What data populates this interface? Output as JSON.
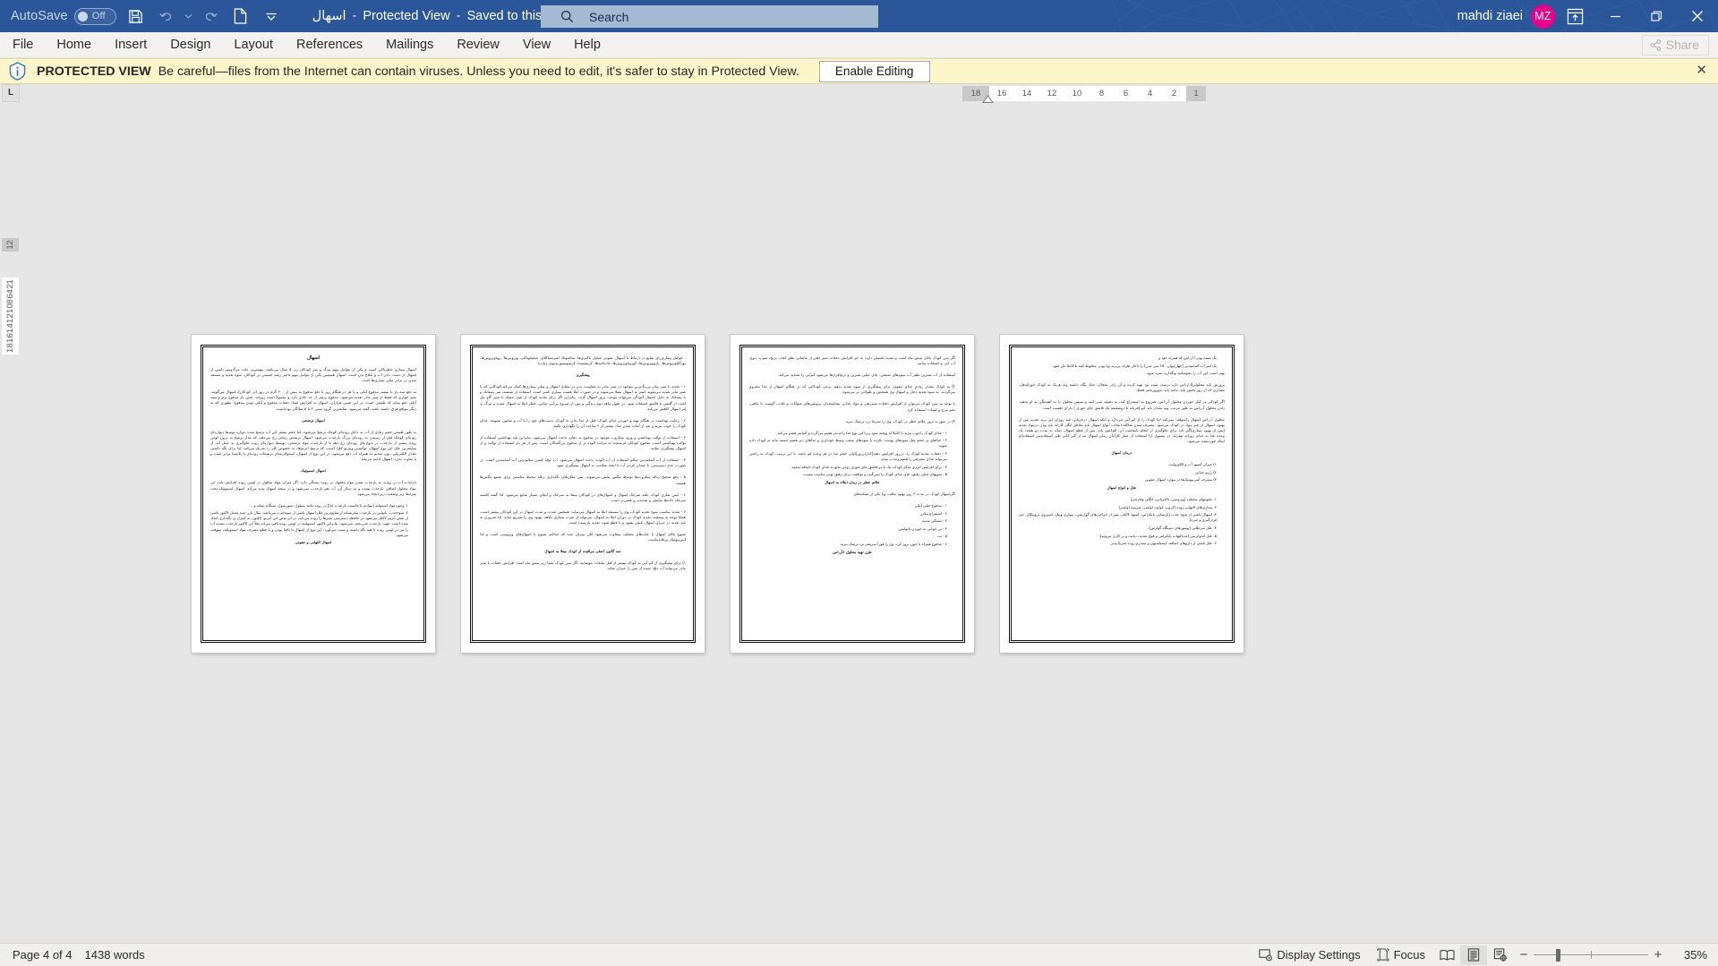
{
  "titlebar": {
    "autosave_label": "AutoSave",
    "autosave_state": "Off",
    "qat": [
      {
        "name": "save-icon",
        "tooltip": "Save"
      },
      {
        "name": "undo-icon",
        "tooltip": "Undo"
      },
      {
        "name": "redo-icon",
        "tooltip": "Redo"
      },
      {
        "name": "new-file-icon",
        "tooltip": "New"
      },
      {
        "name": "customize-qat-chevron-icon",
        "tooltip": "Customize Quick Access Toolbar"
      }
    ],
    "document_name": "اسهال",
    "protected_view_label": "Protected View",
    "save_location": "Saved to this PC",
    "user_name": "mahdi ziaei",
    "avatar_initials": "MZ",
    "avatar_color": "#e3008c",
    "accent_color": "#2b579a",
    "window_buttons": [
      "minimize",
      "restore",
      "close"
    ]
  },
  "search": {
    "placeholder": "Search",
    "icon": "search-icon"
  },
  "ribbon": {
    "tabs": [
      {
        "label": "File"
      },
      {
        "label": "Home"
      },
      {
        "label": "Insert"
      },
      {
        "label": "Design"
      },
      {
        "label": "Layout"
      },
      {
        "label": "References"
      },
      {
        "label": "Mailings"
      },
      {
        "label": "Review"
      },
      {
        "label": "View"
      },
      {
        "label": "Help"
      }
    ],
    "share_label": "Share"
  },
  "protected_view": {
    "icon": "shield-info-icon",
    "heading": "PROTECTED VIEW",
    "message": "Be careful—files from the Internet can contain viruses. Unless you need to edit, it's safer to stay in Protected View.",
    "enable_editing_label": "Enable Editing",
    "close_label": "✕",
    "background_color": "#fdf6ca"
  },
  "rulers": {
    "tabstop_marker": "L",
    "horizontal_numbers": [
      "18",
      "16",
      "14",
      "12",
      "10",
      "8",
      "6",
      "4",
      "2",
      "1"
    ],
    "vertical_numbers": [
      "2",
      "1",
      "1",
      "2",
      "4",
      "6",
      "8",
      "10",
      "12",
      "14",
      "16",
      "18"
    ]
  },
  "statusbar": {
    "page_indicator": "Page 4 of 4",
    "word_count": "1438 words",
    "display_settings_label": "Display Settings",
    "display_settings_icon": "display-settings-icon",
    "focus_label": "Focus",
    "focus_icon": "focus-icon",
    "view_buttons": [
      {
        "name": "read-mode-icon",
        "active": false
      },
      {
        "name": "print-layout-icon",
        "active": true
      },
      {
        "name": "web-layout-icon",
        "active": false
      }
    ],
    "zoom_out_label": "−",
    "zoom_in_label": "+",
    "zoom_level": "35%"
  },
  "document": {
    "page_count": 4,
    "current_page": 4,
    "pages": [
      {
        "number": 1,
        "title": "اسهال",
        "blocks": [
          {
            "type": "p",
            "bold": false,
            "text": "اسهال بیماری خطرناکی است و یکی از عوامل مهم مرگ و میر کودکان زیر ۵ سال می‌باشد. مهمترین علت مرگ‌ومیر ناشی از اسهال از دست دادن آب و املاح بدن است. اسهال همچنین یکی از عوامل مهم تاخیر رشد جسمی در کودکان، سوء تغذیه و مستعد شدن در برابر سایر بیماری‌ها است."
          },
          {
            "type": "p",
            "bold": false,
            "text": "به دفع سه بار یا بیشتر مدفوع آبکی و یا هر در هنگام روز یا دفع مدفوع به بیش از ۲۰۰ گرم در روز (در کودکان)، اسهال می‌گویند. شیر خواری که فقط از شیر مادر تغذیه می‌شود، مدفوع نرم‌تر از حد عادی دارد و معمولاً است روزانه، چنین بار مدفوع نرم و نیمه آبکی دفع نماید که طبیعی است. در این ضمن هزاران، اسهال به افزایش تعداد دفعات مدفوع و آبکی بودن مدفوع، بطوری که به دیگر مواقع فرق داشته باشد، گفته می‌شود. شایعترین گروه سنی ۲ تا ۵ سالگی بوده‌است."
          },
          {
            "type": "p",
            "bold": true,
            "text": "اسهال ترشحی"
          },
          {
            "type": "p",
            "bold": false,
            "text": "به طور طبیعی حجم زیادی از آب به داخل روده‌ای کوچک ترشح می‌شود، اما حجم بیشتر این آب ترشح شده دوباره توسط دیواره‌ای روده‌ای کوچک قبل از رسیدن به روده‌ای بزرگ بازجذب می‌شود. اسهال ترشحی زمانی رخ می‌دهد، که مدل ترشح به درون لومن روده بیشتر از بازجذب در دیواره‌ای روده‌ای رخ دهد یا از بازجذب مواد ترشحی، توسط دیواره‌ای روده جلوگیری به عمل آید. از شایعترین علل این نوع اسهال، توکسین ویبریو کلرا است، که ترشح آنزیم‌ها، به خصوص کلر را تحریک می‌کند، لذا برای نگه داشتن تعادل الکتریکی، یون سدیم به همراه آب دفع می‌شود. در این نوع از اسهال، اسمولاریته‌ای ترشحات روده‌ای با پلاسما برابر است و یا تفاوت ندارد. اسهال ادامه می‌یابد."
          },
          {
            "type": "p",
            "bold": true,
            "text": "اسهال اسموتیک"
          },
          {
            "type": "p",
            "bold": false,
            "text": "بازجذب آب در روده، به بازجذب شدن مواد محلول در روده بستگی دارد. اگر میزان مواد محلول در لومن روده افزایش یابد، این مواد محلول اضافی بازجذب نشده و به دنبال آن، آب هم بازجذب نمی‌شود و در نتیجه اسهال پدید می‌آید. اسهال اسموتیک تحت شرایط زیر وضعیت زیر ایجاد می‌شود:"
          },
          {
            "type": "li",
            "text": "۱. وجود مواد اسمولیه (موادی با خاصیت بازجذب غذا) در روده مانند متیلول، سوربیتول، سنگانه شاید و ..."
          },
          {
            "type": "li",
            "text": "۲. سوءجذب: ناتوانی در بازجذب بیفرشتاند از شایع‌ترین علل اسهال ناشی از سوءجذب می‌باشد. مثال بارز عدم تحمل لاکتوز ناشی از نقص آنزیم لاکتاز می‌شود در حافظه دسترسی شیرها را روده می‌یابد، در اثر نقص این آنزیم، لاکتوز، به کنترل بر نگه‌داری ایجاد شده است. جهت بازجذب غیرریختز نمی‌شود، بنابراین لاکتوز اسمولیته در لومن روده باقی می‌اند مثلاً این لاکتوز بازجذب نشده آب را نیز در لومن روده با هیه نگه داشته و سبب می‌آورد، این نوع از اسهال با تافنا بودن و یا قطع مصرف مواد اسمویکف متوقف می‌شود."
          },
          {
            "type": "p",
            "bold": true,
            "text": "اسهال التهابی و عفونی"
          }
        ]
      },
      {
        "number": 2,
        "title": "",
        "blocks": [
          {
            "type": "p",
            "bold": false,
            "text": ". عوامل بیماری‌زای شایع در ارتباط با اسهال عفونی شامل باکتری‌ها: سالمونلا، اشرشیاکلای، شاپیلوباکتر، ویروس‌ها: روتاویروس‌ها، نورآلکویروس‌ها، پاروویروس‌ها، کوروناویروس‌ها، تک‌یاخته‌ها: کریستیدیا، کریپتوسپوریدیوم، ژیاردیا"
          },
          {
            "type": "p",
            "bold": true,
            "text": "پیشگیری"
          },
          {
            "type": "p",
            "bold": false,
            "text": "۱ - تغذیه با شیر مادر پررنگ‌ترین موجود در شیر مادر به مقاومت بدن در مقابل اسهال و سایر بیماری‌ها کمک می‌کند.کودکانی که با شیر مادر تغذیه می‌شوند کمتر به اسهال مبتلا می‌شوند و در صورت ابتلا هست بیماری کمتر است. استفاده از شیشه، سر پستانک و یا پستانک به دلیل احتمال آلودگی می‌تواند موجب بروز اسهال گردد. بنابراین اگر برای تغذیه کودک از شیر خشک یا شیر گاو نیاز است از گلنش یا قاشق استفاده شود. در طول ماهه دوم زندگی و پس از شروع بی‌آبی تماس، خطر ابتلا به اسهال شدید و مرگ بر اثر اسهال کاهش می‌یابد."
          },
          {
            "type": "p",
            "bold": false,
            "text": "۲ - رعایت بهداشت در هنگام تهیه و خوردن غذای کودک: قبل از غذا دادن به کودک، دست‌های خود را با آب و صابون بشویید. غذای کودک را خوب بپزید و بعد از آماده شدن غذا، بیشتر از ۲ ساعت آن را نگهداری نکنید."
          },
          {
            "type": "p",
            "bold": false,
            "text": "۳ - استفاده از توالت بهداشتی و ورود میکروب موجود در مدفوع به دهان، باعث اسهال می‌شود، بنابراین باید بهداشتی استفاده از توالت بهداشتی است. مدفوع کودکان فرستنده به مراتب آلوده تر از مدفوع بزرگسالان است. پس از هر بار استفاده از توالت و از اسهال پیشگیری نمایید."
          },
          {
            "type": "p",
            "bold": false,
            "text": "۴ - استفاده از آب آشامیدنی سالم استفاده از آب آلوده، باعث اسهال می‌شود. آب لوله کشی سالم‌ترین آب آشامیدنی است. در صورت عدم دسترسی، با چندان کردن آب تا ایجاد سلامت به اسهال پیشگیری شود."
          },
          {
            "type": "p",
            "bold": false,
            "text": "۵ - دفع صحیح زباله میکروب‌ها توسط مگس پخش می‌شوند، پس مکان‌های نگه‌داری زباله محیط مناسبی برای تجمع مگس‌ها هستند."
          },
          {
            "type": "p",
            "bold": false,
            "text": "۶ - ایمن سازی کودک علیه سرخک اسهال و اسهال‌های در کودکان مبتلا به سرخک و آبچای بسیار شایع می‌شود. لذا گفته کاشته سرخک داده‌ها شایعتر و شدیدتر و همین‌تر است."
          },
          {
            "type": "p",
            "bold": false,
            "text": "۷ - تغذیه مناسب سوء تغذیه کودک، وی را مستعد ابتلا به اسهال می‌نماید. همچنین شدت و مدت اسهال در این کودکان بیشتر است. همانا توجه به وضعیت تغذیه کودک در دوران ابتلا به اسهال، می‌تواند از شدت بیماری بکاهد. بهبود وی را تسریع نماید. لذا ضروری به باید تغذیه در جریان اسهال بابقی بشود و یا قطع شود، تغذیه بازیست است."
          },
          {
            "type": "p",
            "bold": false,
            "text": "شیوع بالای اسهال با علت‌های مختلف متفاوت می‌شود لکن میزان عده که حداکثر شیوع با اسهال‌های ویروسی است و لذا آنتی‌بیوتیک بی‌فایده‌است."
          },
          {
            "type": "p",
            "bold": true,
            "text": "سه گانون اصلی مراقبت از کودک مبتلا به اسهال"
          },
          {
            "type": "p",
            "bold": false,
            "text": "۱) برای پیشگیری از کم آبی به کودک بیشتر از قبل مایعات بنوشانید. اگر سن کودک شما زیر شش ماه است افزایش دفعات با شیر مادر می‌تواند آب دلخ عمده از نمن را جبران نماید."
          }
        ]
      },
      {
        "number": 3,
        "title": "",
        "blocks": [
          {
            "type": "p",
            "bold": false,
            "text": "اگر سن کودک بالای شش ماه است و تغذیه تکمیلی دارد، به جز افزایش دفعات شیر دهی از مایعاتی نظیر لعاب برنج، سوپ، دوغ، آب انی و استفاده نمایید."
          },
          {
            "type": "p",
            "bold": false,
            "text": "استفاده از آب شیرین نظیر آب میوه‌های صنعتی، چای خیلی شیرین و نرم‌افزار‌ها می‌شود کم‌آبی را تشدید می‌کند."
          },
          {
            "type": "p",
            "bold": false,
            "text": "۲) به کودک مقدار زیادی غذای مقوی، برای پیشگیری از سوء تغذیه بدهید برخی کودکانی که در هنگام اسهال از غذا محروم می‌گردند، به سوء تغذیه دچار و اسهال وی همچنین و طولانی تر می‌شود."
          },
          {
            "type": "p",
            "bold": false,
            "text": "با توجه به سن کودک می‌توان از افزایش دفعات شیردهی و مواد غذایی نشاسته‌دار، پروتئین‌های حیوانات و غلات، گوشت یا ماهی، تخم مرغ و لبنیات استفاده کرد."
          },
          {
            "type": "p",
            "bold": false,
            "text": "۳) در صورت بروز علائم خطر در کودک، وی را سریعا نزد پزشک ببرید."
          },
          {
            "type": "li",
            "text": "۱ - غذای کودک راخوب بپزید تا کاملا له وپخته شود زیرا این نوع غذا راحت‌تر هضم می‌گردد و آسانتر هضم می‌کند."
          },
          {
            "type": "li",
            "text": "۲ - غذاهای پر حجم مثل میوه‌های پوست نکرده یا میوه‌های سفت وسط خودداری و غذاهای دیر هضم خسته نباید به کودک داده شوند."
          },
          {
            "type": "li",
            "text": "۳ - دفعات تغذیه کودک را، درروز افزایش دهید(۶باردرروز)اولی حجم غذا در هر وعده کم باشد. با این ترتیب، کودک به راحتی می‌تواند غذای مصرفی را هضم وجذب نماید."
          },
          {
            "type": "li",
            "text": "۴ - برای افزایش انرژی غذای کودک، یک یا دو قاشق چای خوری روغن مایع به غذای کودک اضافه نمایید."
          },
          {
            "type": "li",
            "text": "۵ - سوپهای خیلی رقیق، جای غذای کودک را نمی‌گیرد و توافقت برای رقیق بودن مناسب نیست."
          },
          {
            "type": "p",
            "bold": true,
            "text": "علائم خطر در زمان ابتلاء به اسهال"
          },
          {
            "type": "p",
            "bold": false,
            "text": "اگراسهال کودک در مدت ۳ روز بهبود نیافت ویا یکی از نشانه‌های:"
          },
          {
            "type": "li",
            "text": "۱ - مدفوع خیلی آبکی"
          },
          {
            "type": "li",
            "text": "۲ - استفراغ مکرر"
          },
          {
            "type": "li",
            "text": "۳ - تشنگی شدید"
          },
          {
            "type": "li",
            "text": "۴ - بی خوابی به خوردن ناتوانمن"
          },
          {
            "type": "li",
            "text": "۵ - تب"
          },
          {
            "type": "li",
            "text": "۶ - مدفوع همراه با خون بروز کرد، وی را فوراً سریعتر نزد پزشک ببرید."
          },
          {
            "type": "p",
            "bold": true,
            "text": "طرز تهیه محلول ا.آر.اس"
          }
        ]
      },
      {
        "number": 4,
        "title": "",
        "blocks": [
          {
            "type": "li",
            "text": "یک بسته پودر ا.آر.اس که همراه خود و"
          },
          {
            "type": "li",
            "text": "یک لیتر آب آشامیدنی (چهارلیوان ۲۵۰ سی سی) را داخل ظرف پریزید ویا پودر، مخلوط کنید تا کاملا حل شود."
          },
          {
            "type": "p",
            "bold": false,
            "text": "بهتر است این آب را بجوشانید وبگذارید سرد شود."
          },
          {
            "type": "p",
            "bold": false,
            "text": "پرورش باید محلولی(ا.ار.اس تازه درست شده بود تهیه کرده و آن رادر یخچال، خنک نگاه داشته وبه هریک به کودک خوراندهار، مقداری که از روز پخش یابد، مانند باید بدوروزبختر فقط."
          },
          {
            "type": "p",
            "bold": false,
            "text": "اگر کودکی در کنار خوردن محلول آ.ر.اس، هم‌روع به استفراغ کند، به دقیقه صبر کنید و سپس محلول را به آهستگی به او بدهید. دادن محلول آ.ر.اس به طور مرتب، وبه مقدار باید کم (قربانه تا دوشقیقه یک قاشق چای خوری ) دارای اهمیت است."
          },
          {
            "type": "p",
            "bold": false,
            "text": "محلول آ.ر.اس اسهال رامتوقف نمی‌کند اما کودک را از کم آبی می‌دارد و آنکه اسهال درجریانی چند روزان این پرید تغذیه پس از بهبود، اسهال از چیز مواد در کودک می‌شود. مصرف شدن شاکله انتخاب انواع اسهال باید بخاطر انگار کارانه باید ویان درمواد تغذیه (پس از بهبود بیماری)گیر باید برای جلوگیری از انجام نامناسب آن، افزایش باید. پس از قطع اسهال، نماند به مدت دو هفته، یک وعده غذا به غذای روزانه بیفزاید. در معمول ازا استفاده از عمل کارادان زمان اسهال مه از گیر کانی طی استفاده‌می استفاده‌ام اینکه خوردشده می‌شود."
          },
          {
            "type": "p",
            "bold": true,
            "text": "درمان اسهال"
          },
          {
            "type": "li",
            "text": "۱) جبران کمبود آب و الکترولیت"
          },
          {
            "type": "li",
            "text": "۲) رژیم غذائی"
          },
          {
            "type": "li",
            "text": "۳) مصرف آنتی‌بیوتیک‌ها در موارد اسهال عفونی"
          },
          {
            "type": "p",
            "bold": true,
            "text": "علل و انواع اسهال"
          },
          {
            "type": "li",
            "text": "۱. عفونتهای مختلف (ویروسی، باکتریایی، انگلی وقارچی)"
          },
          {
            "type": "li",
            "text": "۲. بیماری‌های التهابی روده (کرون، کولیت اولسر، شربیته اولسر)"
          },
          {
            "type": "li",
            "text": "۳. اسهال ناشی از سوء جذب (نارسایی پانکراس، کمبود لاکتاز، پس از جراحی‌های گوارشی، بیماری ویپل، اسپروی تروپیکال، غیر قرارگیری و غیره)."
          },
          {
            "type": "li",
            "text": "۴. علل سرطانی (تومورهای دستگاه گوارش)."
          },
          {
            "type": "li",
            "text": "۵. علل اندوکرینی (غدد‌التهاب پانکراس و فوق تغذیه، دیابت و پر کاری تیروئید)."
          },
          {
            "type": "li",
            "text": "۶. علل ناشی از دارو‌های اضافه، ایستاسیون و سندرم روده تحریک‌پذیر."
          }
        ]
      }
    ]
  }
}
